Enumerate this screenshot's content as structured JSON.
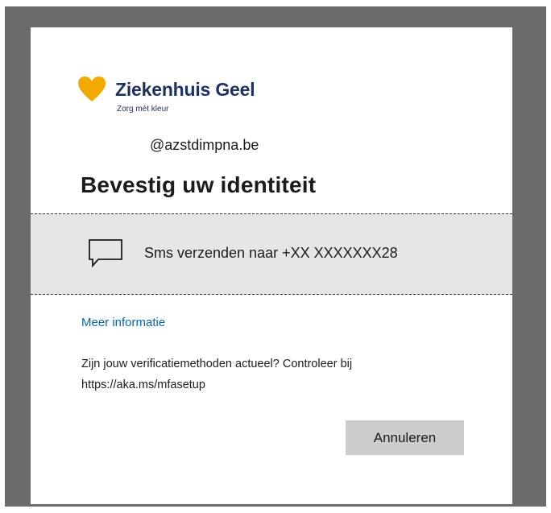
{
  "logo": {
    "name": "Ziekenhuis Geel",
    "tagline": "Zorg mét kleur",
    "heart_color": "#f2a900",
    "text_color": "#1e3165"
  },
  "account": {
    "email": "@azstdimpna.be"
  },
  "title": "Bevestig uw identiteit",
  "option": {
    "icon": "chat-bubble-icon",
    "label": "Sms verzenden naar +XX XXXXXXX28"
  },
  "more_info_link": "Meer informatie",
  "verify_text": {
    "line1": "Zijn jouw verificatiemethoden actueel? Controleer bij",
    "line2": "https://aka.ms/mfasetup"
  },
  "buttons": {
    "cancel_label": "Annuleren"
  },
  "colors": {
    "link": "#0067b8",
    "option_bg": "#e6e6e6",
    "button_bg": "#cccccc",
    "backdrop": "#6b6b6b"
  }
}
